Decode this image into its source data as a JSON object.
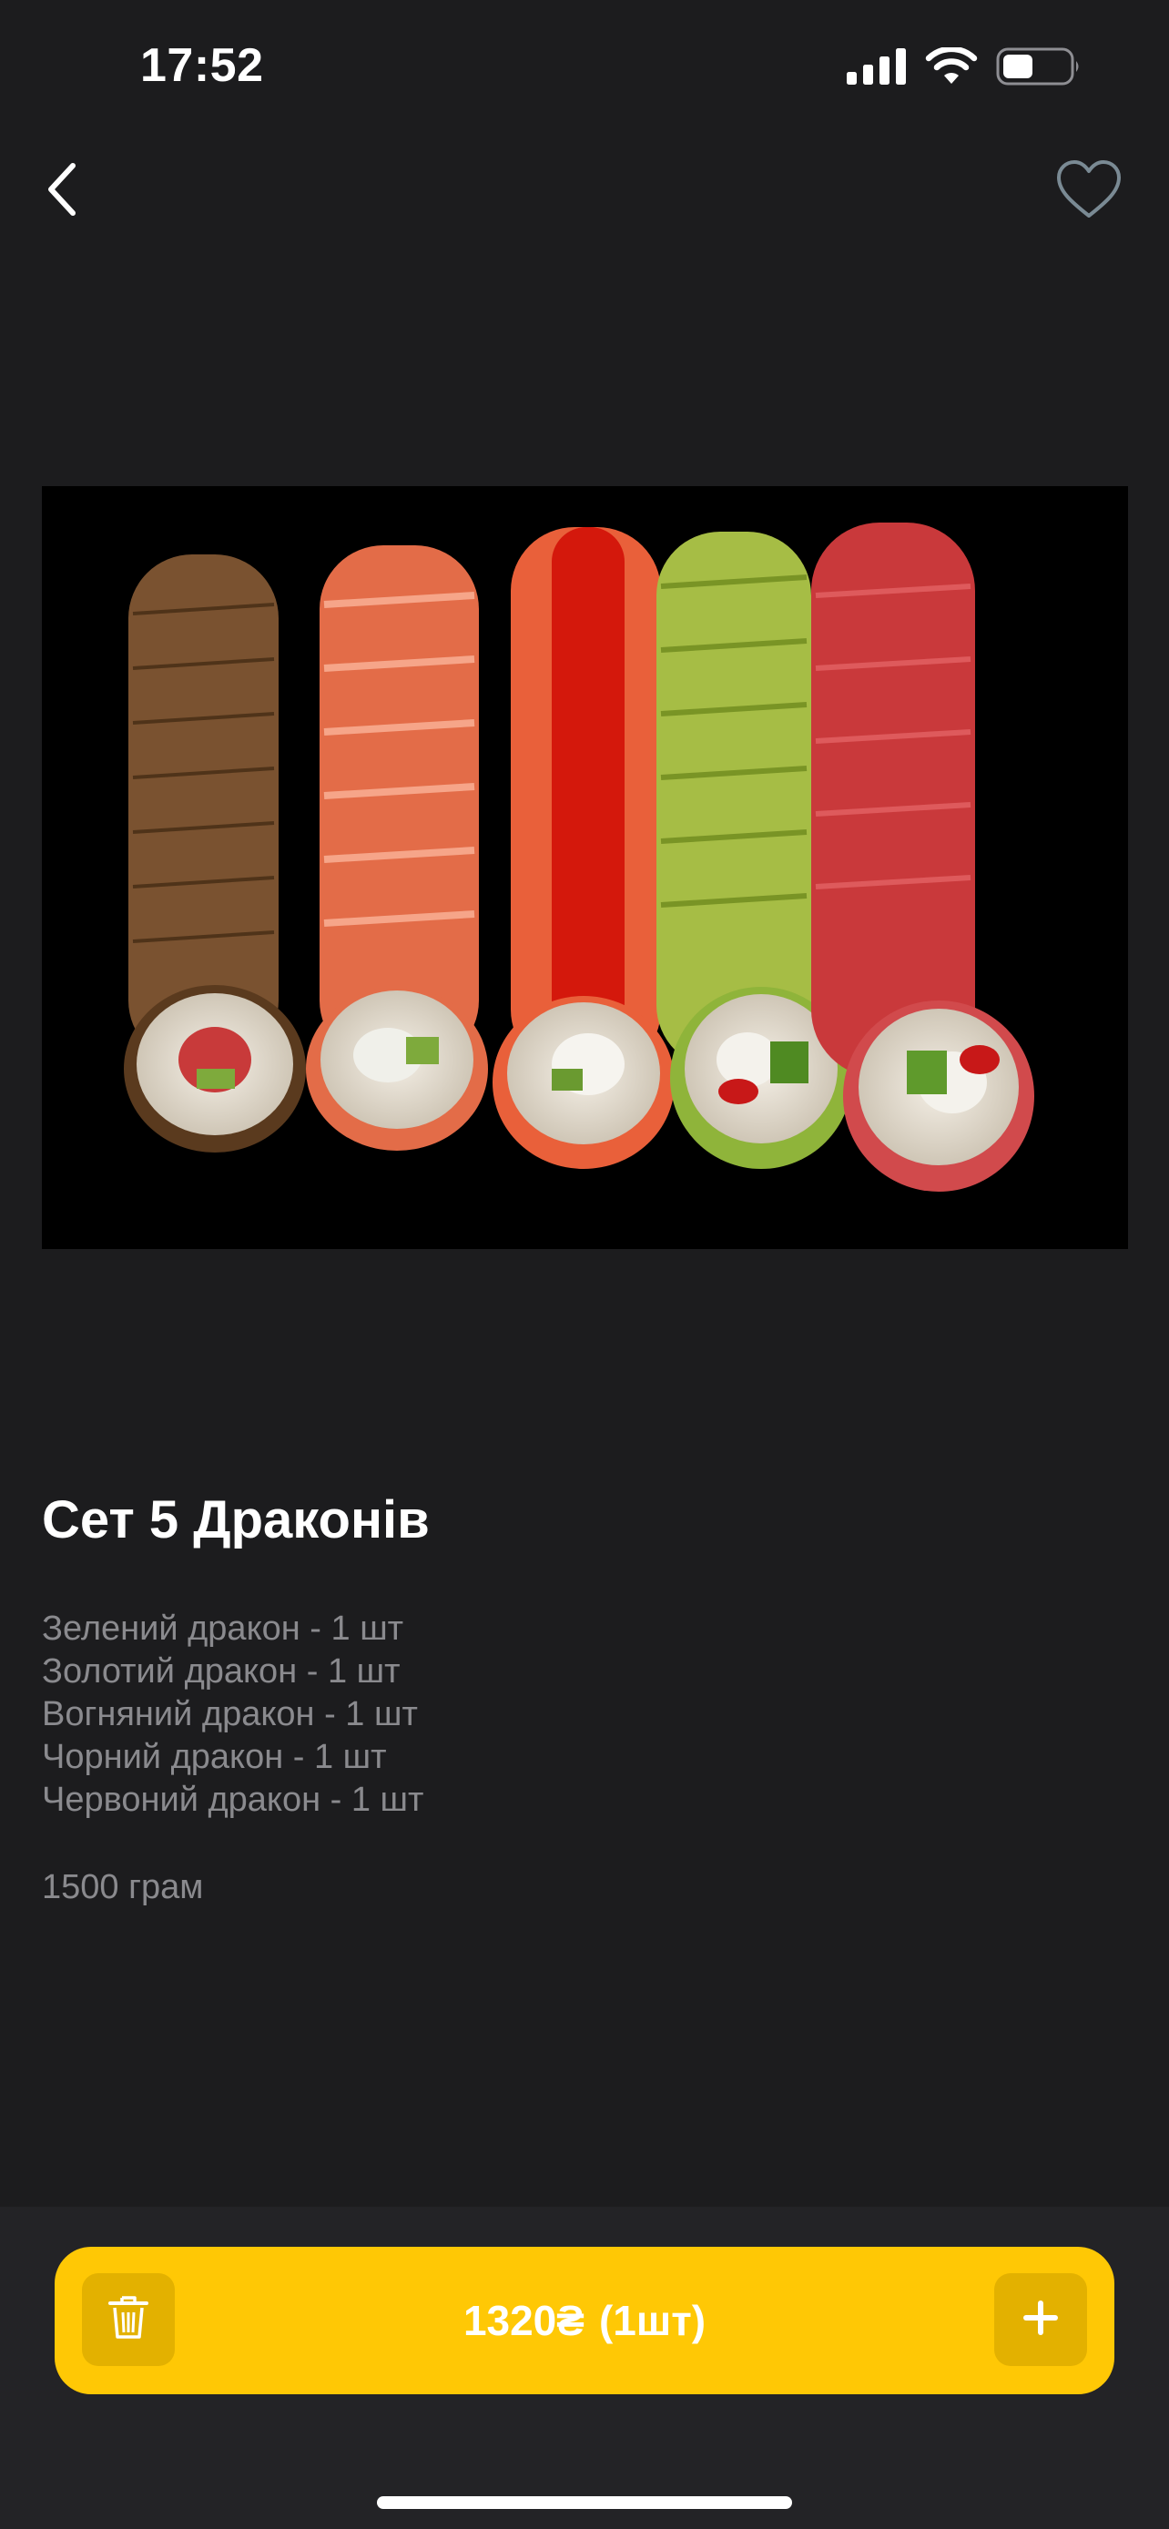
{
  "status_bar": {
    "time": "17:52"
  },
  "nav": {
    "back_icon": "chevron-left-icon",
    "favorite_icon": "heart-outline-icon"
  },
  "product": {
    "image_alt": "sushi-set-photo",
    "title": "Сет 5 Драконів",
    "composition": [
      "Зелений дракон - 1 шт",
      "Золотий дракон - 1 шт",
      "Вогняний дракон - 1 шт",
      "Чорний дракон - 1 шт",
      "Червоний дракон - 1 шт"
    ],
    "weight": "1500 грам"
  },
  "cart": {
    "price": "1320₴",
    "quantity": "(1шт)",
    "remove_icon": "trash-icon",
    "add_icon": "plus-icon"
  },
  "colors": {
    "background": "#1c1c1e",
    "bottom_panel": "#232326",
    "accent": "#ffc805",
    "accent_dark": "#e3b100",
    "muted_text": "#8a8a8e"
  }
}
